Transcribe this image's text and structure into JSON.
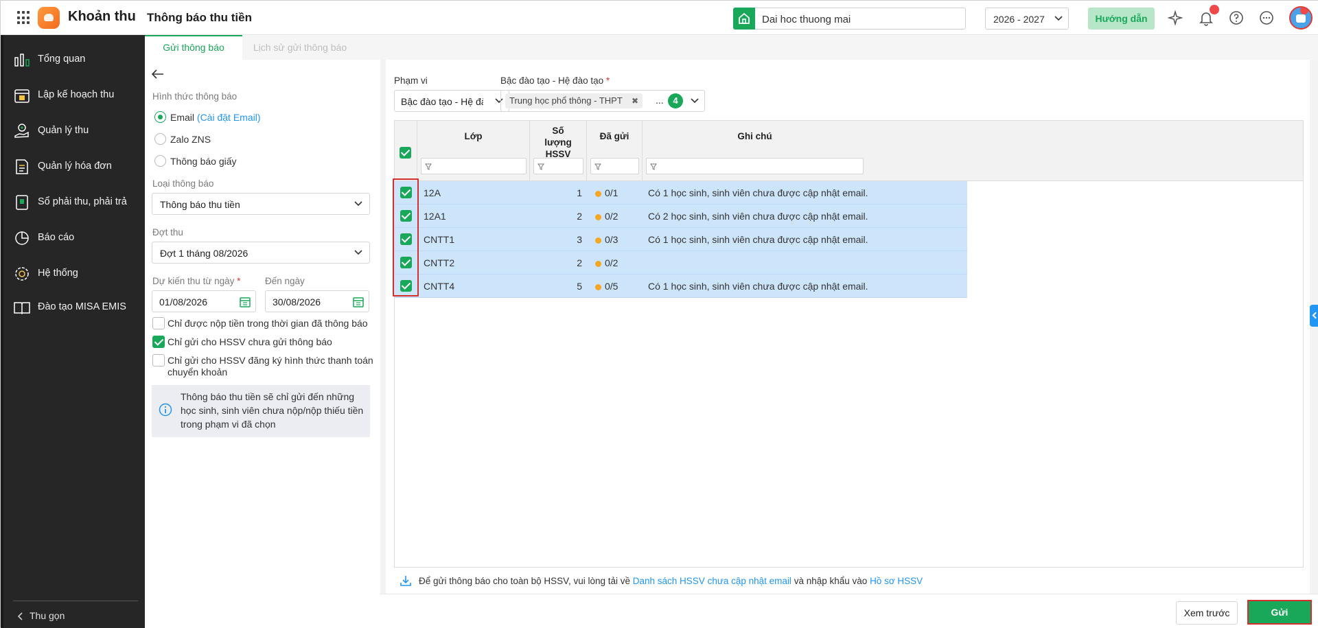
{
  "app": {
    "title": "Khoản thu",
    "page_title": "Thông báo thu tiền"
  },
  "topbar": {
    "school": "Dai hoc thuong mai",
    "year": "2026 - 2027",
    "guide": "Hướng dẫn"
  },
  "sidebar": {
    "items": [
      {
        "label": "Tổng quan",
        "icon": "chart-bar-icon"
      },
      {
        "label": "Lập kế hoạch thu",
        "icon": "plan-calendar-icon"
      },
      {
        "label": "Quản lý thu",
        "icon": "hand-money-icon"
      },
      {
        "label": "Quản lý hóa đơn",
        "icon": "invoice-icon"
      },
      {
        "label": "Sổ phải thu, phải trả",
        "icon": "ledger-icon"
      },
      {
        "label": "Báo cáo",
        "icon": "pie-chart-icon"
      },
      {
        "label": "Hệ thống",
        "icon": "gear-icon"
      },
      {
        "label": "Đào tạo MISA EMIS",
        "icon": "book-icon"
      }
    ],
    "collapse": "Thu gọn"
  },
  "tabs": {
    "send": "Gửi thông báo",
    "history": "Lịch sử gửi thông báo"
  },
  "left": {
    "notify_type_label": "Hình thức thông báo",
    "email_label": "Email",
    "email_setting": "(Cài đặt Email)",
    "zalo": "Zalo ZNS",
    "paper": "Thông báo giấy",
    "type_label": "Loại thông báo",
    "type_value": "Thông báo thu tiền",
    "period_label": "Đợt thu",
    "period_value": "Đợt 1 tháng 08/2026",
    "from_label": "Dự kiến thu từ ngày",
    "from_value": "01/08/2026",
    "to_label": "Đến ngày",
    "to_value": "30/08/2026",
    "check1": "Chỉ được nộp tiền trong thời gian đã thông báo",
    "check2": "Chỉ gửi cho HSSV chưa gửi thông báo",
    "check3": "Chỉ gửi cho HSSV đăng ký hình thức thanh toán chuyển khoản",
    "info": "Thông báo thu tiền sẽ chỉ gửi đến những học sinh, sinh viên chưa nộp/nộp thiếu tiền trong phạm vi đã chọn"
  },
  "right": {
    "scope_label": "Phạm vi",
    "scope_value": "Bậc đào tạo - Hệ đào tạo",
    "level_label": "Bậc đào tạo - Hệ đào tạo",
    "chip": "Trung học phổ thông - THPT",
    "more": "...",
    "count": "4",
    "columns": {
      "class": "Lớp",
      "qty": "Số lượng HSSV",
      "sent": "Đã gửi",
      "note": "Ghi chú"
    },
    "rows": [
      {
        "class": "12A",
        "qty": "1",
        "sent": "0/1",
        "note": "Có 1 học sinh, sinh viên chưa được cập nhật email."
      },
      {
        "class": "12A1",
        "qty": "2",
        "sent": "0/2",
        "note": "Có 2 học sinh, sinh viên chưa được cập nhật email."
      },
      {
        "class": "CNTT1",
        "qty": "3",
        "sent": "0/3",
        "note": "Có 1 học sinh, sinh viên chưa được cập nhật email."
      },
      {
        "class": "CNTT2",
        "qty": "2",
        "sent": "0/2",
        "note": ""
      },
      {
        "class": "CNTT4",
        "qty": "5",
        "sent": "0/5",
        "note": "Có 1 học sinh, sinh viên chưa được cập nhật email."
      }
    ],
    "bottom_msg1": "Để gửi thông báo cho toàn bộ HSSV, vui lòng tải về",
    "bottom_link1": "Danh sách HSSV chưa cập nhật email",
    "bottom_msg2": "và nhập khẩu vào",
    "bottom_link2": "Hồ sơ HSSV"
  },
  "footer": {
    "preview": "Xem trước",
    "send": "Gửi"
  },
  "colors": {
    "accent": "#19a75a",
    "selected_row": "#cde5fb",
    "link": "#2196f3",
    "warning_dot": "#f5a623"
  }
}
